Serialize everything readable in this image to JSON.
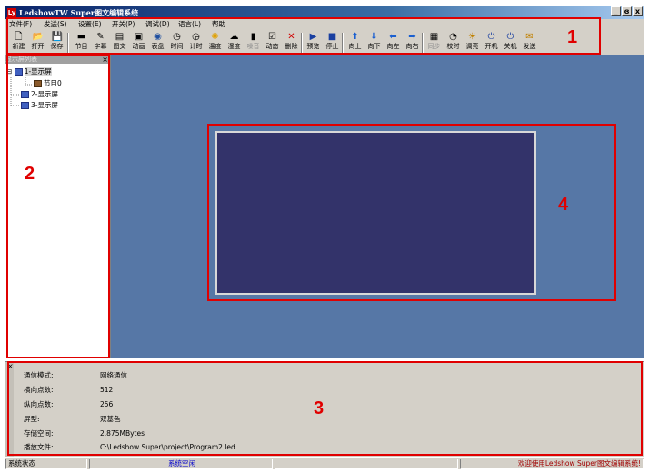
{
  "window": {
    "app_icon": "Ly",
    "title": "LedshowTW Super图文编辑系统",
    "controls": [
      "_",
      "ɞ",
      "x"
    ]
  },
  "menu": [
    "文件(F)",
    "发送(S)",
    "设置(E)",
    "开关(P)",
    "调试(D)",
    "语言(L)",
    "帮助"
  ],
  "toolbar": [
    {
      "label": "新建",
      "icon": "new-file-icon",
      "glyph": "🗋"
    },
    {
      "label": "打开",
      "icon": "open-folder-icon",
      "glyph": "📂"
    },
    {
      "label": "保存",
      "icon": "save-disk-icon",
      "glyph": "💾"
    },
    {
      "label": "节目",
      "icon": "program-icon",
      "glyph": "▬"
    },
    {
      "label": "字幕",
      "icon": "subtitle-icon",
      "glyph": "✎"
    },
    {
      "label": "图文",
      "icon": "image-text-icon",
      "glyph": "▤"
    },
    {
      "label": "动画",
      "icon": "animation-icon",
      "glyph": "▣"
    },
    {
      "label": "表盘",
      "icon": "dial-icon",
      "glyph": "◉"
    },
    {
      "label": "时间",
      "icon": "clock-icon",
      "glyph": "◷"
    },
    {
      "label": "计时",
      "icon": "timer-icon",
      "glyph": "◶"
    },
    {
      "label": "温度",
      "icon": "temperature-icon",
      "glyph": "✺"
    },
    {
      "label": "湿度",
      "icon": "humidity-icon",
      "glyph": "☁"
    },
    {
      "label": "噪音",
      "icon": "noise-icon",
      "glyph": "▮",
      "disabled": true
    },
    {
      "label": "动态",
      "icon": "dynamic-icon",
      "glyph": "☑"
    },
    {
      "label": "删除",
      "icon": "delete-icon",
      "glyph": "✕"
    },
    {
      "label": "预览",
      "icon": "preview-icon",
      "glyph": "▶"
    },
    {
      "label": "停止",
      "icon": "stop-icon",
      "glyph": "■"
    },
    {
      "label": "向上",
      "icon": "arrow-up-icon",
      "glyph": "⬆"
    },
    {
      "label": "向下",
      "icon": "arrow-down-icon",
      "glyph": "⬇"
    },
    {
      "label": "向左",
      "icon": "arrow-left-icon",
      "glyph": "⬅"
    },
    {
      "label": "向右",
      "icon": "arrow-right-icon",
      "glyph": "➡"
    },
    {
      "label": "同步",
      "icon": "sync-icon",
      "glyph": "▦",
      "disabled": true
    },
    {
      "label": "校时",
      "icon": "time-sync-icon",
      "glyph": "◔"
    },
    {
      "label": "调亮",
      "icon": "brightness-icon",
      "glyph": "☀"
    },
    {
      "label": "开机",
      "icon": "power-on-icon",
      "glyph": "⏻"
    },
    {
      "label": "关机",
      "icon": "power-off-icon",
      "glyph": "⏻"
    },
    {
      "label": "发送",
      "icon": "send-icon",
      "glyph": "✉"
    }
  ],
  "left_panel": {
    "header": "显示屏列表",
    "close": "×",
    "tree": [
      {
        "label": "1-显示屏",
        "toggle": "⊟",
        "selected": true
      },
      {
        "label": "节目0"
      },
      {
        "label": "2-显示屏"
      },
      {
        "label": "3-显示屏"
      }
    ]
  },
  "info": [
    {
      "label": "通信模式:",
      "value": "网络通信"
    },
    {
      "label": "横向点数:",
      "value": "512"
    },
    {
      "label": "纵向点数:",
      "value": "256"
    },
    {
      "label": "屏型:",
      "value": "双基色"
    },
    {
      "label": "存储空间:",
      "value": "2.875MBytes"
    },
    {
      "label": "播放文件:",
      "value": "C:\\Ledshow Super\\project\\Program2.led"
    }
  ],
  "bottom_close": "×",
  "status": {
    "state": "系统状态",
    "comm": "系统空闲",
    "welcome": "欢迎使用Ledshow Super图文编辑系统!"
  },
  "callouts": [
    "1",
    "2",
    "3",
    "4"
  ],
  "colors": {
    "workspace": "#5677a6",
    "screen": "#33336a",
    "callout": "#e00000",
    "status_comm": "#0000cc",
    "status_welcome": "#a00000"
  }
}
